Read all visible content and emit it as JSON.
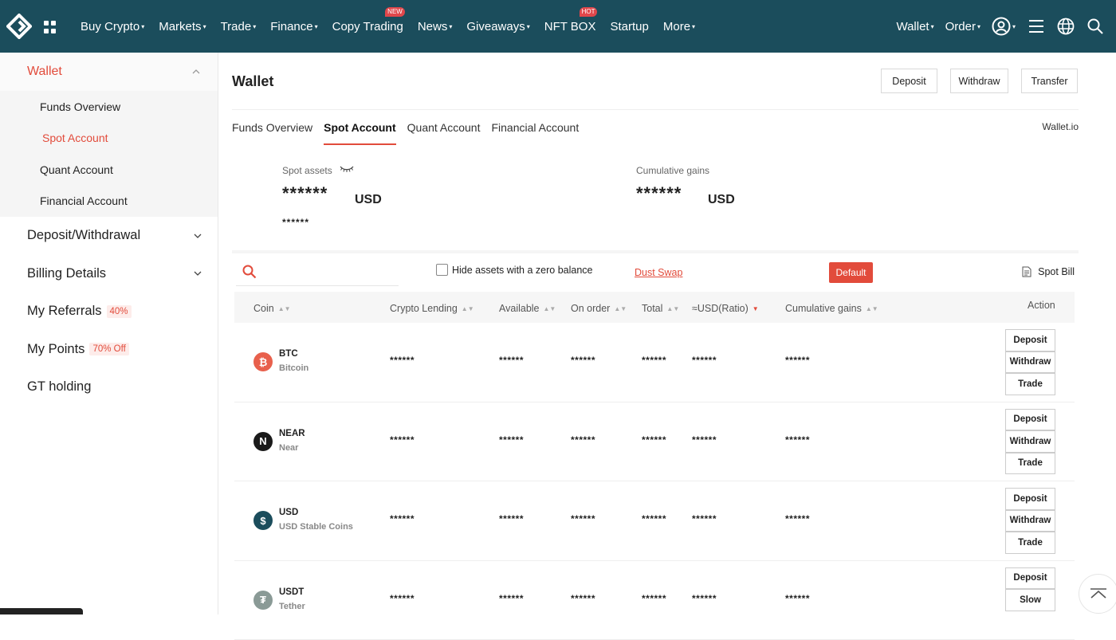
{
  "nav": {
    "items": [
      {
        "label": "Buy Crypto",
        "caret": true,
        "badge": ""
      },
      {
        "label": "Markets",
        "caret": true,
        "badge": ""
      },
      {
        "label": "Trade",
        "caret": true,
        "badge": ""
      },
      {
        "label": "Finance",
        "caret": true,
        "badge": ""
      },
      {
        "label": "Copy Trading",
        "caret": false,
        "badge": "NEW"
      },
      {
        "label": "News",
        "caret": true,
        "badge": ""
      },
      {
        "label": "Giveaways",
        "caret": true,
        "badge": ""
      },
      {
        "label": "NFT BOX",
        "caret": false,
        "badge": "HOT"
      },
      {
        "label": "Startup",
        "caret": false,
        "badge": ""
      },
      {
        "label": "More",
        "caret": true,
        "badge": ""
      }
    ],
    "wallet_label": "Wallet",
    "order_label": "Order",
    "icons": [
      "logo-icon",
      "apps-grid-icon",
      "user-icon",
      "menu-icon",
      "globe-icon",
      "search-icon"
    ],
    "colors": {
      "bar": "#1b4d5c",
      "accent": "#e24b3b"
    }
  },
  "sidebar": {
    "wallet": {
      "label": "Wallet"
    },
    "sub_items": [
      {
        "label": "Funds Overview",
        "active": false
      },
      {
        "label": "Spot Account",
        "active": true
      },
      {
        "label": "Quant Account",
        "active": false
      },
      {
        "label": "Financial Account",
        "active": false
      }
    ],
    "items": [
      {
        "label": "Deposit/Withdrawal",
        "tag": "",
        "chevron": true
      },
      {
        "label": "Billing Details",
        "tag": "",
        "chevron": true
      },
      {
        "label": "My Referrals",
        "tag": "40%",
        "chevron": false
      },
      {
        "label": "My Points",
        "tag": "70% Off",
        "chevron": false
      },
      {
        "label": "GT holding",
        "tag": "",
        "chevron": false
      }
    ]
  },
  "main": {
    "title": "Wallet",
    "buttons": {
      "deposit": "Deposit",
      "withdraw": "Withdraw",
      "transfer": "Transfer"
    },
    "tabs": [
      {
        "label": "Funds Overview",
        "active": false
      },
      {
        "label": "Spot Account",
        "active": true
      },
      {
        "label": "Quant Account",
        "active": false
      },
      {
        "label": "Financial Account",
        "active": false
      }
    ],
    "wallet_io": "Wallet.io",
    "spot_assets": {
      "label": "Spot assets",
      "value": "******",
      "unit": "USD",
      "sub": "******"
    },
    "cumulative_gains": {
      "label": "Cumulative gains",
      "value": "******",
      "unit": "USD"
    },
    "filters": {
      "search_placeholder": "",
      "hide_zero_label": "Hide assets with a zero balance",
      "hide_zero_checked": false,
      "dust_swap": "Dust Swap",
      "default_btn": "Default",
      "spot_bill": "Spot Bill"
    },
    "table": {
      "columns": [
        "Coin",
        "Crypto Lending",
        "Available",
        "On order",
        "Total",
        "≈USD(Ratio)",
        "Cumulative gains",
        "Action"
      ],
      "rows": [
        {
          "symbol": "BTC",
          "name": "Bitcoin",
          "icon": "bitcoin-icon",
          "glyph": "₿",
          "color": "#e8604c",
          "values": [
            "******",
            "******",
            "******",
            "******",
            "******",
            "******"
          ],
          "actions": [
            "Deposit",
            "Withdraw",
            "Trade"
          ]
        },
        {
          "symbol": "NEAR",
          "name": "Near",
          "icon": "near-icon",
          "glyph": "Ν",
          "color": "#1a1a1a",
          "values": [
            "******",
            "******",
            "******",
            "******",
            "******",
            "******"
          ],
          "actions": [
            "Deposit",
            "Withdraw",
            "Trade"
          ]
        },
        {
          "symbol": "USD",
          "name": "USD Stable Coins",
          "icon": "dollar-icon",
          "glyph": "$",
          "color": "#1b4d5c",
          "values": [
            "******",
            "******",
            "******",
            "******",
            "******",
            "******"
          ],
          "actions": [
            "Deposit",
            "Withdraw",
            "Trade"
          ]
        },
        {
          "symbol": "USDT",
          "name": "Tether",
          "icon": "tether-icon",
          "glyph": "₮",
          "color": "#8a9a96",
          "values": [
            "******",
            "******",
            "******",
            "******",
            "******",
            "******"
          ],
          "actions": [
            "Deposit",
            "Slow"
          ]
        }
      ]
    }
  }
}
